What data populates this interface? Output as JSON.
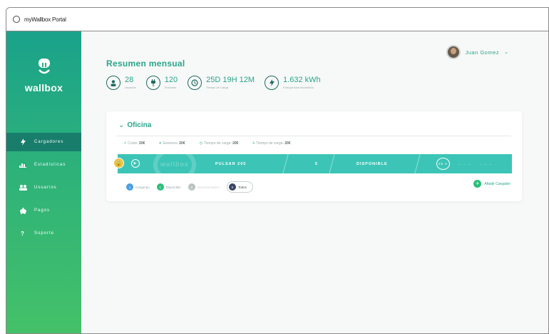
{
  "window": {
    "title": "myWallbox Portal"
  },
  "brand": {
    "name": "wallbox"
  },
  "sidebar": {
    "items": [
      {
        "label": "Cargadores",
        "icon": "bolt-icon",
        "active": true
      },
      {
        "label": "Estadísticas",
        "icon": "bar-chart-icon",
        "active": false
      },
      {
        "label": "Usuarios",
        "icon": "users-icon",
        "active": false
      },
      {
        "label": "Pagos",
        "icon": "piggy-bank-icon",
        "active": false
      },
      {
        "label": "Soporte",
        "icon": "question-icon",
        "active": false
      }
    ]
  },
  "user": {
    "name": "Juan Gomez"
  },
  "summary": {
    "title": "Resumen mensual",
    "stats": [
      {
        "value": "28",
        "label": "Usuarios",
        "icon": "user-icon"
      },
      {
        "value": "120",
        "label": "Sesiones",
        "icon": "plug-icon"
      },
      {
        "value": "25D 19H 12M",
        "label": "Tiempo de Carga",
        "icon": "clock-icon"
      },
      {
        "value": "1.632 kWh",
        "label": "Energía total transferida",
        "icon": "bolt-icon"
      }
    ]
  },
  "group": {
    "name": "Oficina",
    "metrics": [
      {
        "label": "Coste:",
        "value": "20€",
        "icon": "trend-icon"
      },
      {
        "label": "Sesiones:",
        "value": "20€",
        "icon": "plug-icon"
      },
      {
        "label": "Tiempo de carga:",
        "value": "20€",
        "icon": "clock-icon"
      },
      {
        "label": "Tiempo de carga:",
        "value": "20€",
        "icon": "bolt-icon"
      }
    ],
    "charger": {
      "name": "PULSAR 205",
      "number": "5",
      "status": "DISPONIBLE",
      "power": "26 A",
      "brand_watermark": "wallbox"
    },
    "filters": [
      {
        "count": "1",
        "label": "Cargando",
        "color": "#4a9ee6"
      },
      {
        "count": "1",
        "label": "Disponible",
        "color": "#2bbf7a"
      },
      {
        "count": "0",
        "label": "Desconectados",
        "color": "#b9c2c2"
      },
      {
        "count": "3",
        "label": "Todos",
        "color": "#3a4566"
      }
    ],
    "add_label": "Añadir Cargador"
  }
}
